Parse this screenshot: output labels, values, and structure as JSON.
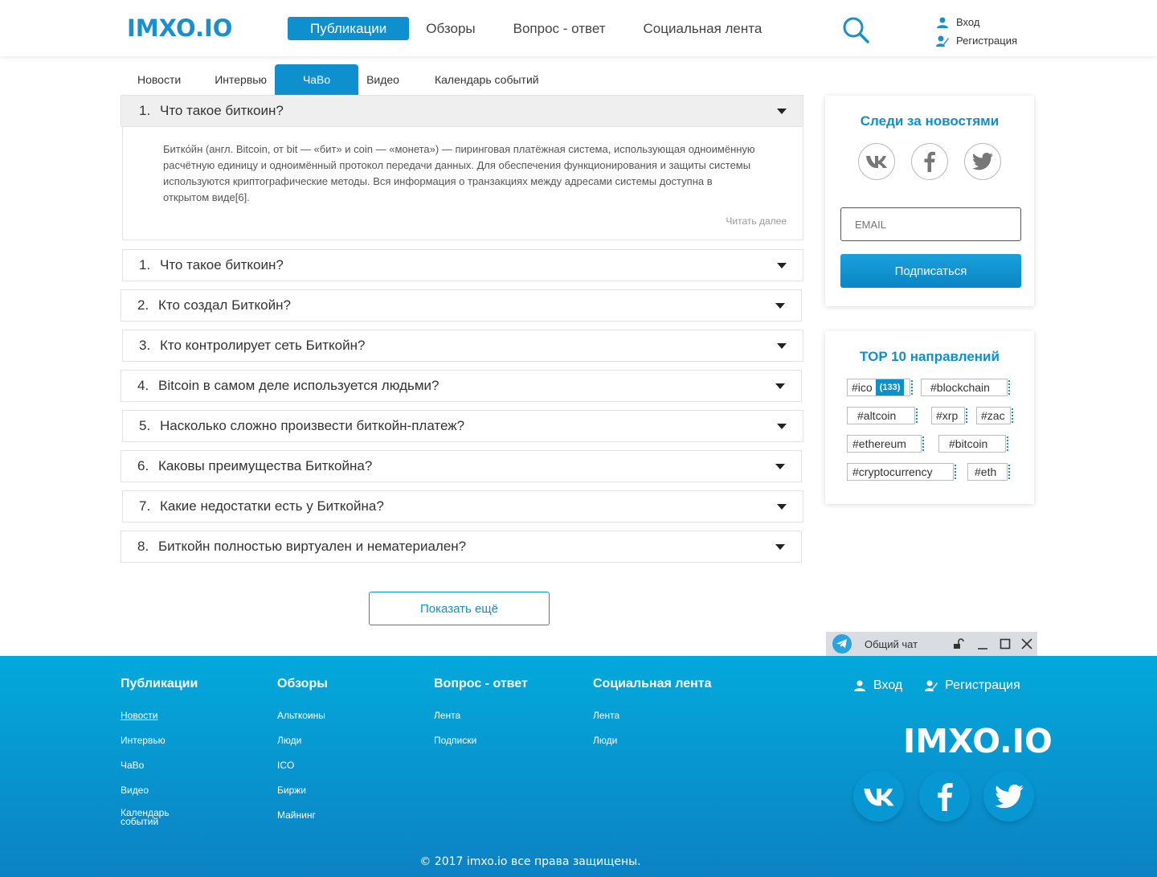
{
  "header": {
    "logo": "IMXO.IO",
    "nav": [
      "Публикации",
      "Обзоры",
      "Вопрос - ответ",
      "Социальная лента"
    ],
    "login": "Вход",
    "register": "Регистрация"
  },
  "subtabs": [
    "Новости",
    "Интервью",
    "ЧаВо",
    "Видео",
    "Календарь событий"
  ],
  "faq_open": {
    "num": "1.",
    "question": "Что такое биткоин?",
    "answer": "Битко́йн (англ. Bitcoin, от bit — «бит» и coin — «монета») — пиринговая платёжная система, использующая одноимённую расчётную единицу и одноимённый протокол передачи данных. Для обеспечения функционирования и защиты системы используются криптографические методы. Вся информация о транзакциях между адресами системы доступна в открытом виде[6].",
    "read_more": "Читать далее"
  },
  "faq_items": [
    {
      "num": "1.",
      "q": "Что такое биткоин?"
    },
    {
      "num": "2.",
      "q": "Кто создал Биткойн?"
    },
    {
      "num": "3.",
      "q": "Кто контролирует сеть Биткойн?"
    },
    {
      "num": "4.",
      "q": "Bitcoin в самом деле используется людьми?"
    },
    {
      "num": "5.",
      "q": "Насколько сложно произвести биткойн-платеж?"
    },
    {
      "num": "6.",
      "q": "Каковы преимущества Биткойна?"
    },
    {
      "num": "7.",
      "q": "Какие недостатки есть у Биткойна?"
    },
    {
      "num": "8.",
      "q": "Биткойн полностью виртуален и нематериален?"
    }
  ],
  "show_more": "Показать ещё",
  "subscribe": {
    "title": "Следи за новостями",
    "email_placeholder": "EMAIL",
    "button": "Подписаться"
  },
  "top": {
    "title": "TOP 10 направлений",
    "tags": [
      {
        "label": "#ico",
        "count": "(133)"
      },
      {
        "label": "#blockchain"
      },
      {
        "label": "#altcoin"
      },
      {
        "label": "#xrp"
      },
      {
        "label": "#zac"
      },
      {
        "label": "#ethereum"
      },
      {
        "label": "#bitcoin"
      },
      {
        "label": "#cryptocurrency"
      },
      {
        "label": "#eth"
      }
    ]
  },
  "chat": {
    "title": "Общий чат"
  },
  "footer": {
    "col1": {
      "head": "Публикации",
      "links": [
        "Новости",
        "Интервью",
        "ЧаВо",
        "Видео",
        "Календарь событий"
      ]
    },
    "col2": {
      "head": "Обзоры",
      "links": [
        "Альткоины",
        "Люди",
        "ICO",
        "Биржи",
        "Майнинг"
      ]
    },
    "col3": {
      "head": "Вопрос - ответ",
      "links": [
        "Лента",
        "Подписки"
      ]
    },
    "col4": {
      "head": "Социальная лента",
      "links": [
        "Лента",
        "Люди"
      ]
    },
    "login": "Вход",
    "register": "Регистрация",
    "logo": "IMXO.IO",
    "copyright": "© 2017 imxo.io все права защищены."
  },
  "colors": {
    "accent": "#0e90cf",
    "footer_top": "#03a9dc",
    "footer_bottom": "#0c82c3"
  }
}
